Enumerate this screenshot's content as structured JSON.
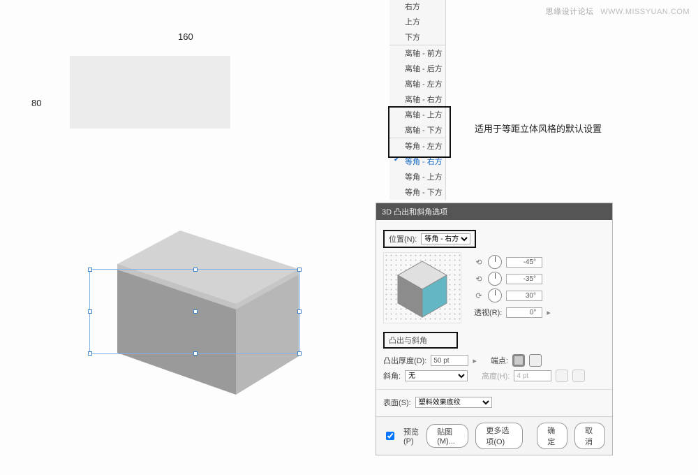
{
  "watermark": {
    "han": "思缘设计论坛",
    "url": "WWW.MISSYUAN.COM"
  },
  "flat_rect": {
    "width_label": "160",
    "height_label": "80"
  },
  "context_menu": {
    "group_a": [
      "右方",
      "上方",
      "下方"
    ],
    "group_b": [
      "离轴 - 前方",
      "离轴 - 后方",
      "离轴 - 左方",
      "离轴 - 右方",
      "离轴 - 上方",
      "离轴 - 下方"
    ],
    "group_c": [
      "等角 - 左方",
      "等角 - 右方",
      "等角 - 上方",
      "等角 - 下方"
    ],
    "selected_index_c": 1
  },
  "ctx_caption": "适用于等距立体风格的默认设置",
  "dialog": {
    "title": "3D 凸出和斜角选项",
    "position_label": "位置(N):",
    "position_value": "等角 - 右方",
    "rot_x": "-45°",
    "rot_y": "-35°",
    "rot_z": "30°",
    "perspective_label": "透视(R):",
    "perspective_value": "0°",
    "section_label": "凸出与斜角",
    "depth_label": "凸出厚度(D):",
    "depth_value": "50 pt",
    "cap_label": "端点:",
    "bevel_label": "斜角:",
    "bevel_value": "无",
    "bevel_h_label": "高度(H):",
    "bevel_h_value": "4 pt",
    "surface_label": "表面(S):",
    "surface_value": "塑料效果底纹",
    "preview_label": "预览(P)",
    "map_btn": "贴图(M)...",
    "more_btn": "更多选项(O)",
    "ok_btn": "确定",
    "cancel_btn": "取消"
  }
}
